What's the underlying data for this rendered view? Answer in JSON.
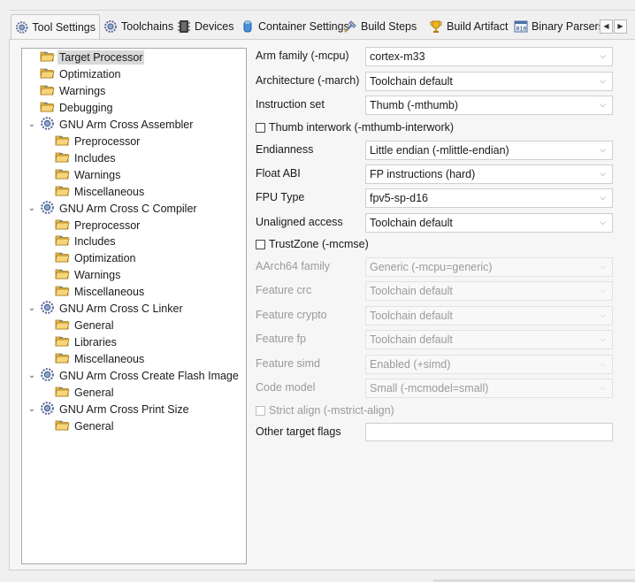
{
  "tabs": [
    {
      "label": "Tool Settings",
      "icon": "gear-icon",
      "active": true
    },
    {
      "label": "Toolchains",
      "icon": "gear-icon"
    },
    {
      "label": "Devices",
      "icon": "chip-icon"
    },
    {
      "label": "Container Settings",
      "icon": "cylinder-icon"
    },
    {
      "label": "Build Steps",
      "icon": "tools-icon"
    },
    {
      "label": "Build Artifact",
      "icon": "trophy-icon"
    },
    {
      "label": "Binary Parsers",
      "icon": "binary-icon"
    }
  ],
  "tab_nav": {
    "left": "◀",
    "right": "▶"
  },
  "tree": {
    "items": [
      {
        "label": "Target Processor",
        "type": "folder",
        "selected": true
      },
      {
        "label": "Optimization",
        "type": "folder"
      },
      {
        "label": "Warnings",
        "type": "folder"
      },
      {
        "label": "Debugging",
        "type": "folder"
      },
      {
        "label": "GNU Arm Cross Assembler",
        "type": "tool",
        "expanded": true
      },
      {
        "label": "Preprocessor",
        "type": "folder"
      },
      {
        "label": "Includes",
        "type": "folder"
      },
      {
        "label": "Warnings",
        "type": "folder"
      },
      {
        "label": "Miscellaneous",
        "type": "folder"
      },
      {
        "label": "GNU Arm Cross C Compiler",
        "type": "tool",
        "expanded": true
      },
      {
        "label": "Preprocessor",
        "type": "folder"
      },
      {
        "label": "Includes",
        "type": "folder"
      },
      {
        "label": "Optimization",
        "type": "folder"
      },
      {
        "label": "Warnings",
        "type": "folder"
      },
      {
        "label": "Miscellaneous",
        "type": "folder"
      },
      {
        "label": "GNU Arm Cross C Linker",
        "type": "tool",
        "expanded": true
      },
      {
        "label": "General",
        "type": "folder"
      },
      {
        "label": "Libraries",
        "type": "folder"
      },
      {
        "label": "Miscellaneous",
        "type": "folder"
      },
      {
        "label": "GNU Arm Cross Create Flash Image",
        "type": "tool",
        "expanded": true
      },
      {
        "label": "General",
        "type": "folder"
      },
      {
        "label": "GNU Arm Cross Print Size",
        "type": "tool",
        "expanded": true
      },
      {
        "label": "General",
        "type": "folder"
      }
    ]
  },
  "form": {
    "arm_family": {
      "label": "Arm family (-mcpu)",
      "value": "cortex-m33"
    },
    "architecture": {
      "label": "Architecture (-march)",
      "value": "Toolchain default"
    },
    "instruction_set": {
      "label": "Instruction set",
      "value": "Thumb (-mthumb)"
    },
    "thumb_interwork": {
      "label": "Thumb interwork (-mthumb-interwork)",
      "checked": false
    },
    "endianness": {
      "label": "Endianness",
      "value": "Little endian (-mlittle-endian)"
    },
    "float_abi": {
      "label": "Float ABI",
      "value": "FP instructions (hard)"
    },
    "fpu_type": {
      "label": "FPU Type",
      "value": "fpv5-sp-d16"
    },
    "unaligned_access": {
      "label": "Unaligned access",
      "value": "Toolchain default"
    },
    "trustzone": {
      "label": "TrustZone (-mcmse)",
      "checked": false
    },
    "aarch64_family": {
      "label": "AArch64 family",
      "value": "Generic (-mcpu=generic)",
      "disabled": true
    },
    "feature_crc": {
      "label": "Feature crc",
      "value": "Toolchain default",
      "disabled": true
    },
    "feature_crypto": {
      "label": "Feature crypto",
      "value": "Toolchain default",
      "disabled": true
    },
    "feature_fp": {
      "label": "Feature fp",
      "value": "Toolchain default",
      "disabled": true
    },
    "feature_simd": {
      "label": "Feature simd",
      "value": "Enabled (+simd)",
      "disabled": true
    },
    "code_model": {
      "label": "Code model",
      "value": "Small (-mcmodel=small)",
      "disabled": true
    },
    "strict_align": {
      "label": "Strict align (-mstrict-align)",
      "checked": false,
      "disabled": true
    },
    "other_target_flags": {
      "label": "Other target flags",
      "value": ""
    }
  },
  "dropdown_chevron": "⌵"
}
